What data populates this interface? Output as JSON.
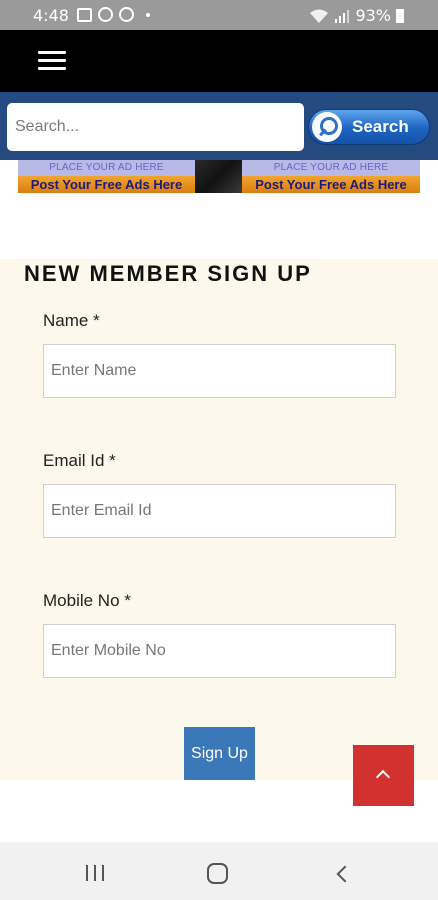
{
  "status_bar": {
    "time": "4:48",
    "battery": "93%",
    "icons": [
      "image-icon",
      "whatsapp-icon",
      "whatsapp-icon",
      "dot-icon",
      "wifi-icon",
      "signal-icon",
      "battery-icon"
    ]
  },
  "header": {
    "menu_icon": "hamburger-menu-icon"
  },
  "search": {
    "placeholder": "Search...",
    "value": "",
    "button_label": "Search",
    "bar_color": "#254a80"
  },
  "ad_banner": {
    "top_text_left": "PLACE YOUR AD HERE",
    "bottom_text_left": "Post Your Free Ads Here",
    "top_text_right": "PLACE YOUR AD HERE",
    "bottom_text_right": "Post Your Free Ads Here"
  },
  "form": {
    "title": "NEW MEMBER SIGN UP",
    "fields": [
      {
        "label": "Name *",
        "placeholder": "Enter Name",
        "value": ""
      },
      {
        "label": "Email Id *",
        "placeholder": "Enter Email Id",
        "value": ""
      },
      {
        "label": "Mobile No *",
        "placeholder": "Enter Mobile No",
        "value": ""
      }
    ],
    "submit_label": "Sign Up",
    "panel_color": "#fcf8ec",
    "button_color": "#3a78b8"
  },
  "scroll_top": {
    "icon": "chevron-up-icon",
    "color": "#d3312f"
  },
  "nav_bar": {
    "icons": [
      "recent-apps-icon",
      "home-icon",
      "back-icon"
    ]
  }
}
